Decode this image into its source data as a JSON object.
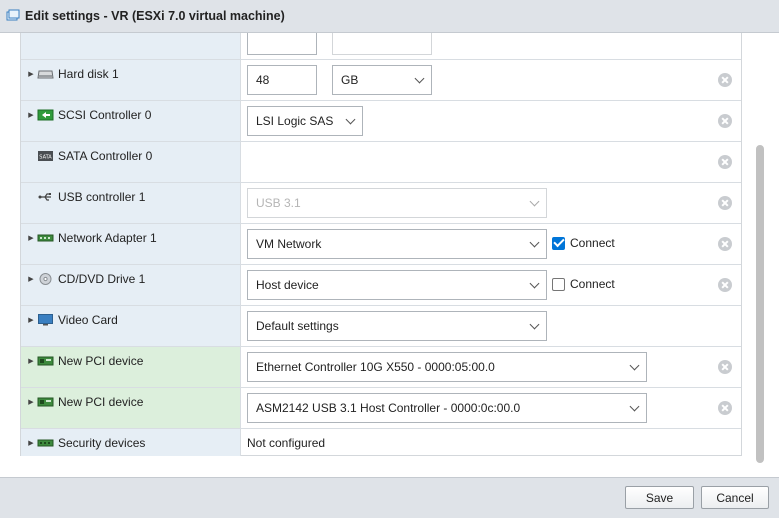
{
  "window": {
    "title": "Edit settings - VR (ESXi 7.0 virtual machine)"
  },
  "rows": {
    "hard_disk": {
      "label": "Hard disk 1",
      "size_value": "48",
      "unit": "GB"
    },
    "scsi": {
      "label": "SCSI Controller 0",
      "value": "LSI Logic SAS"
    },
    "sata": {
      "label": "SATA Controller 0"
    },
    "usb": {
      "label": "USB controller 1",
      "value": "USB 3.1"
    },
    "network": {
      "label": "Network Adapter 1",
      "value": "VM Network",
      "connect_label": "Connect",
      "connected": true
    },
    "cddvd": {
      "label": "CD/DVD Drive 1",
      "value": "Host device",
      "connect_label": "Connect",
      "connected": false
    },
    "video": {
      "label": "Video Card",
      "value": "Default settings"
    },
    "pci1": {
      "label": "New PCI device",
      "value": "Ethernet Controller 10G X550 - 0000:05:00.0"
    },
    "pci2": {
      "label": "New PCI device",
      "value": "ASM2142 USB 3.1 Host Controller - 0000:0c:00.0"
    },
    "security": {
      "label": "Security devices",
      "value": "Not configured"
    }
  },
  "footer": {
    "save_label": "Save",
    "cancel_label": "Cancel"
  },
  "colors": {
    "label_bg": "#e6eef5",
    "pci_bg": "#dcefdc",
    "checkbox_accent": "#0075d8"
  }
}
